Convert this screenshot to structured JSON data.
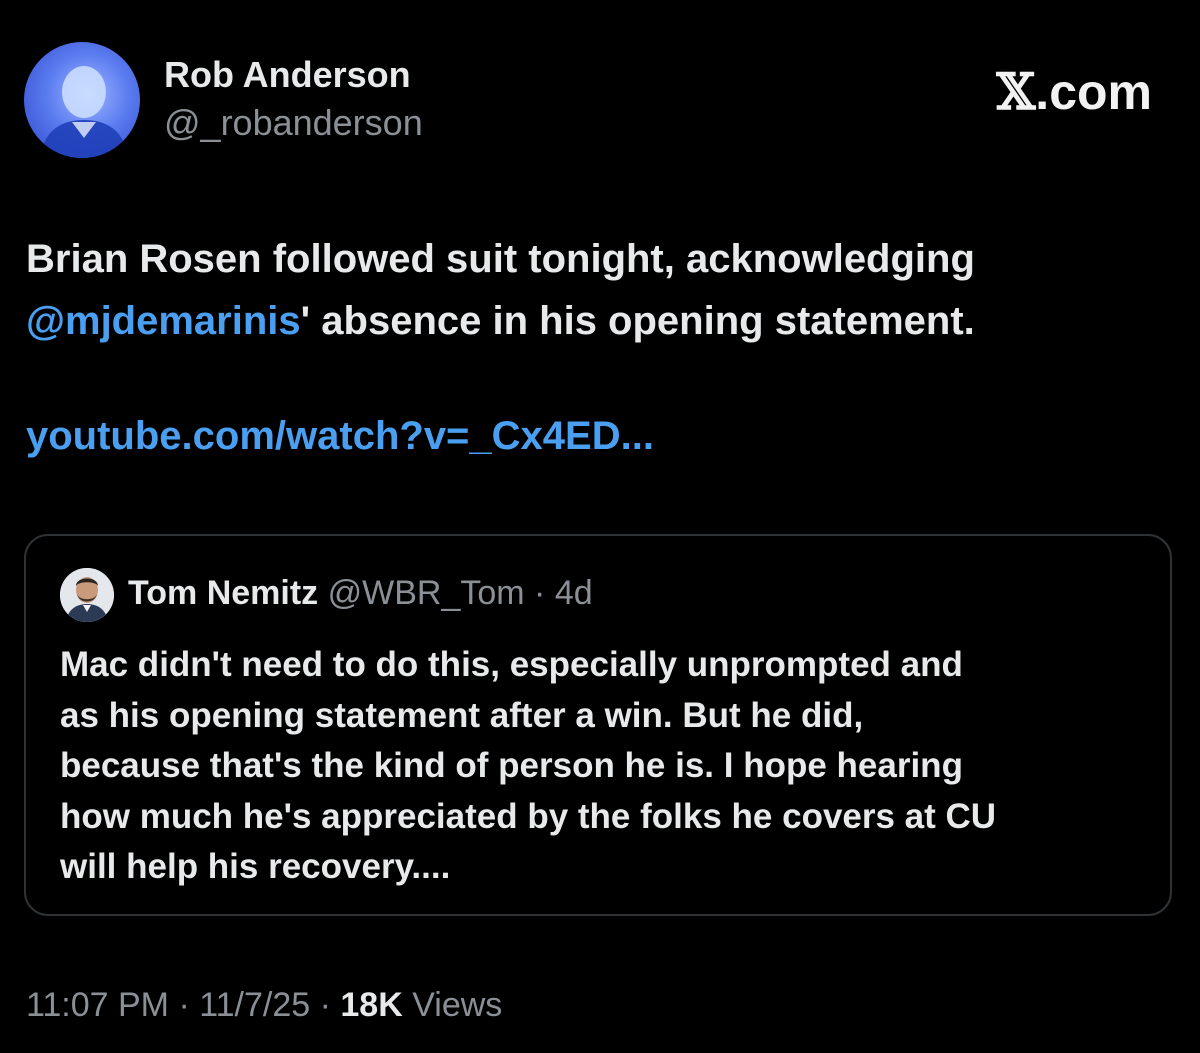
{
  "author": {
    "name": "Rob Anderson",
    "handle": "@_robanderson"
  },
  "brand": {
    "x_glyph": "𝕏",
    "label": ".com"
  },
  "tweet": {
    "line1": "Brian Rosen followed suit tonight, acknowledging",
    "mention": "@mjdemarinis",
    "line2_rest": "'  absence in his opening statement.",
    "link": "youtube.com/watch?v=_Cx4ED..."
  },
  "quote": {
    "name": "Tom Nemitz",
    "handle": "@WBR_Tom",
    "separator": " · ",
    "age": "4d",
    "lines": [
      "Mac didn't need to do this, especially unprompted and",
      "as his opening statement after a win. But he did,",
      "because that's the kind of person he is. I hope hearing",
      "how much he's appreciated by the folks he covers at CU",
      "will help his recovery...."
    ]
  },
  "footer": {
    "time": "11:07 PM",
    "sep1": " · ",
    "date": "11/7/25",
    "sep2": " · ",
    "views_count": "18K",
    "views_label": " Views"
  },
  "colors": {
    "background": "#000000",
    "text": "#e7e9ea",
    "muted": "#8b9096",
    "link": "#4a9ff0",
    "border": "#2f3336"
  }
}
